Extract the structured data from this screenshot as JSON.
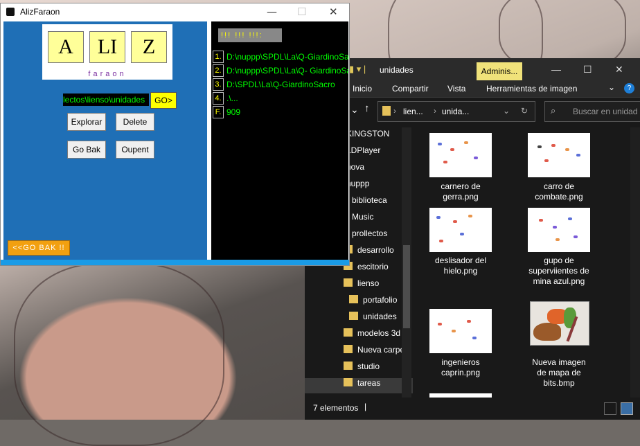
{
  "explorer": {
    "title": "unidades",
    "contextual_tab": "Adminis...",
    "ribbon": [
      "Inicio",
      "Compartir",
      "Vista",
      "Herramientas de imagen"
    ],
    "address": [
      "lien...",
      "unida..."
    ],
    "search_placeholder": "Buscar en unidad",
    "nav": [
      "KINGSTON",
      "LDPlayer",
      "nova",
      "nuppp",
      "biblioteca",
      "Music",
      "prollectos",
      "desarrollo",
      "escitorio",
      "lienso",
      "portafolio",
      "unidades",
      "modelos 3d",
      "Nueva carpe",
      "studio",
      "tareas"
    ],
    "files": [
      [
        "carnero de",
        "gerra.png"
      ],
      [
        "carro de",
        "combate.png"
      ],
      [
        "deslisador del",
        "hielo.png"
      ],
      [
        "gupo de",
        "superviientes de",
        "mina azul.png"
      ],
      [
        "ingenieros",
        "caprin.png"
      ],
      [
        "Nueva imagen",
        "de mapa de",
        "bits.bmp"
      ]
    ],
    "status": "7 elementos"
  },
  "aliz": {
    "title": "AlizFaraon",
    "logo_letters": [
      "A",
      "LI",
      "Z"
    ],
    "logo_sub": "faraon",
    "path": "lectos\\lienso\\unidades",
    "go": "GO>",
    "buttons": {
      "explorar": "Explorar",
      "delete": "Delete",
      "gobak": "Go Bak",
      "oupent": "Oupent"
    },
    "gobak_bar": "<<GO BAK !!",
    "console_header": "!!! !!! !!!:",
    "console_lines": [
      {
        "n": "1.",
        "t": "D:\\nuppp\\SPDL\\La\\Q-GiardinoSa"
      },
      {
        "n": "2.",
        "t": "D:\\nuppp\\SPDL\\La\\Q- GiardinoSa"
      },
      {
        "n": "3.",
        "t": "D:\\SPDL\\La\\Q-GiardinoSacro"
      },
      {
        "n": "4.",
        "t": ".\\..."
      },
      {
        "n": "F.",
        "t": "909"
      }
    ]
  },
  "colors": {
    "panel_blue": "#1f6fb6",
    "console_green": "#00ff00",
    "tile_yellow": "#ffff99",
    "folder": "#e6c15a"
  }
}
